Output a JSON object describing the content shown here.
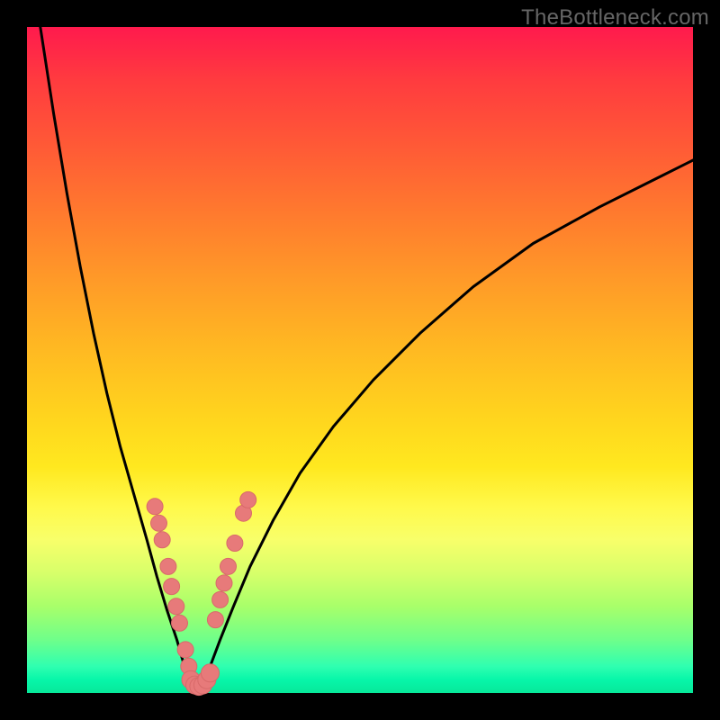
{
  "watermark": "TheBottleneck.com",
  "chart_data": {
    "type": "line",
    "title": "",
    "xlabel": "",
    "ylabel": "",
    "xlim": [
      0,
      100
    ],
    "ylim": [
      0,
      100
    ],
    "grid": false,
    "legend": false,
    "series": [
      {
        "name": "curve-left",
        "x": [
          2,
          4,
          6,
          8,
          10,
          12,
          14,
          16,
          18,
          19.5,
          21,
          22.5,
          23.5,
          24.2,
          24.7,
          25
        ],
        "y": [
          100,
          87,
          75,
          64,
          54,
          45,
          37,
          30,
          23,
          17.5,
          12.5,
          8,
          4.5,
          2.5,
          1.2,
          0.5
        ]
      },
      {
        "name": "curve-right",
        "x": [
          25,
          26,
          27.5,
          29,
          31,
          33.5,
          37,
          41,
          46,
          52,
          59,
          67,
          76,
          86,
          95,
          100
        ],
        "y": [
          0.5,
          1.5,
          4,
          8,
          13,
          19,
          26,
          33,
          40,
          47,
          54,
          61,
          67.5,
          73,
          77.5,
          80
        ]
      },
      {
        "name": "valley-floor",
        "x": [
          24.5,
          25,
          25.5,
          26,
          26.5,
          27
        ],
        "y": [
          1.5,
          0.8,
          0.6,
          0.7,
          1.0,
          1.6
        ]
      }
    ],
    "markers_left": [
      {
        "x": 19.2,
        "y": 28.0
      },
      {
        "x": 19.8,
        "y": 25.5
      },
      {
        "x": 20.3,
        "y": 23.0
      },
      {
        "x": 21.2,
        "y": 19.0
      },
      {
        "x": 21.7,
        "y": 16.0
      },
      {
        "x": 22.4,
        "y": 13.0
      },
      {
        "x": 22.9,
        "y": 10.5
      },
      {
        "x": 23.8,
        "y": 6.5
      },
      {
        "x": 24.3,
        "y": 4.0
      }
    ],
    "markers_right": [
      {
        "x": 28.3,
        "y": 11.0
      },
      {
        "x": 29.0,
        "y": 14.0
      },
      {
        "x": 29.6,
        "y": 16.5
      },
      {
        "x": 30.2,
        "y": 19.0
      },
      {
        "x": 31.2,
        "y": 22.5
      },
      {
        "x": 32.5,
        "y": 27.0
      },
      {
        "x": 33.2,
        "y": 29.0
      }
    ],
    "markers_bottom": [
      {
        "x": 24.6,
        "y": 2.0
      },
      {
        "x": 25.2,
        "y": 1.2
      },
      {
        "x": 25.8,
        "y": 1.0
      },
      {
        "x": 26.4,
        "y": 1.2
      },
      {
        "x": 27.0,
        "y": 2.0
      },
      {
        "x": 27.5,
        "y": 3.0
      }
    ],
    "colors": {
      "curve": "#000000",
      "marker_fill": "#e77a7a",
      "marker_stroke": "#d86a6a"
    }
  }
}
